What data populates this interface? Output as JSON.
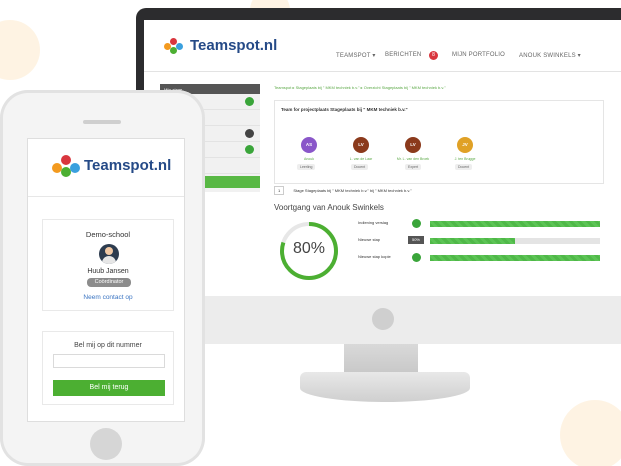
{
  "monitor": {
    "brand": "Teamspot.nl",
    "nav": {
      "teamspot": "TEAMSPOT ▾",
      "berichten": "BERICHTEN",
      "berichten_badge": "8",
      "portfolio": "MIJN PORTFOLIO",
      "user": "ANOUK SWINKELS ▾"
    },
    "sidebar": {
      "header": "Mijn stage",
      "items": [
        "Stageplaats",
        "",
        "",
        "Stageplaats",
        ""
      ],
      "button": "Naar projectleerdje"
    },
    "breadcrumb": "Teamspot ▸ Stageplaats bij \" MKM techniek b.v.\" ▸ Overzicht Stageplaats bij \" MKM techniek b.v.\"",
    "team": {
      "title": "Team for projectplaats Stageplaats bij \" MKM techniek b.v.\"",
      "members": [
        {
          "initials": "AS",
          "name": "Anouk",
          "role": "Leerling",
          "color": "#8a57c9"
        },
        {
          "initials": "LV",
          "name": "L. van de Laar",
          "role": "Docent",
          "color": "#8b3a1c"
        },
        {
          "initials": "LV",
          "name": "Mr. L. van den Broek",
          "role": "Expert",
          "color": "#8b3a1c"
        },
        {
          "initials": "JV",
          "name": "J. ten Brugge",
          "role": "Docent",
          "color": "#e0a126"
        }
      ]
    },
    "stage_line": {
      "num": "1",
      "text": "Stage Stageplaats bij \" MKM techniek b.v.\" bij \" MKM techniek b.v.\""
    },
    "progress": {
      "title": "Voortgang van Anouk Swinkels",
      "overall": "80%",
      "overall_value": 0.8,
      "rows": [
        {
          "label": "Indiening verslag",
          "status": "done",
          "fill": 1.0
        },
        {
          "label": "Nieuwe stap",
          "status": "pct",
          "pct_label": "50%",
          "fill": 0.5
        },
        {
          "label": "Nieuwe stap kopie",
          "status": "done",
          "fill": 1.0
        }
      ]
    }
  },
  "phone": {
    "brand": "Teamspot.nl",
    "school": "Demo-school",
    "person": "Huub Jansen",
    "role": "Coördinator",
    "contact_link": "Neem contact op",
    "call_title": "Bel mij op dit nummer",
    "call_placeholder": "",
    "call_button": "Bel mij terug"
  },
  "colors": {
    "brand_blue": "#254a87",
    "accent_green": "#4caf32",
    "accent_orange": "#f39a1f"
  }
}
